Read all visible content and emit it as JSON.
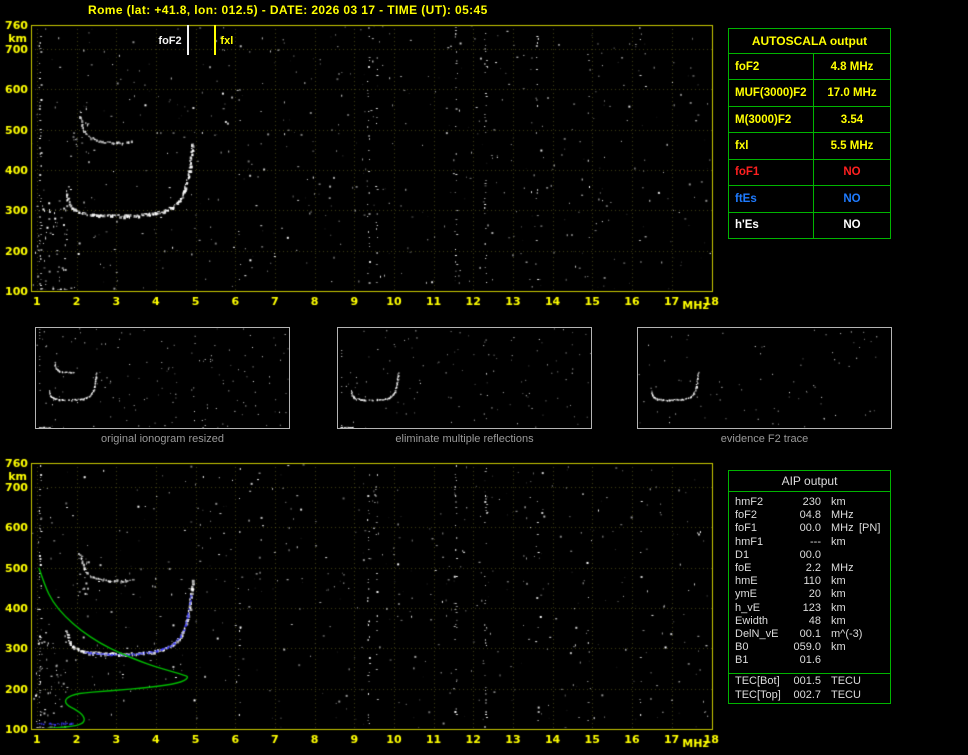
{
  "page": {
    "title": "Rome (lat: +41.8, lon: 012.5) - DATE: 2026 03 17 - TIME (UT): 05:45"
  },
  "colors": {
    "background": "#000000",
    "title_text": "#ffff00",
    "axis_text": "#ffff00",
    "plot_border": "#c8c800",
    "grid": "#bebe3c",
    "table_border": "#00b400",
    "profile_green": "#00bb00",
    "restored_blue": "#3c3cff",
    "echo_white": "#ffffff",
    "caption_gray": "#9a9a9a",
    "aip_text": "#dcdcdc"
  },
  "autoscala_table": {
    "title": "AUTOSCALA output",
    "rows": [
      {
        "param": "foF2",
        "value": "4.8 MHz",
        "color": "#ffff00"
      },
      {
        "param": "MUF(3000)F2",
        "value": "17.0 MHz",
        "color": "#ffff00"
      },
      {
        "param": "M(3000)F2",
        "value": "3.54",
        "color": "#ffff00"
      },
      {
        "param": "fxl",
        "value": "5.5 MHz",
        "color": "#ffff00"
      },
      {
        "param": "foF1",
        "value": "NO",
        "color": "#ff2020"
      },
      {
        "param": "ftEs",
        "value": "NO",
        "color": "#1f7bff"
      },
      {
        "param": "h'Es",
        "value": "NO",
        "color": "#ffffff"
      }
    ]
  },
  "mini_panels": [
    {
      "caption": "original ionogram resized"
    },
    {
      "caption": "eliminate multiple reflections"
    },
    {
      "caption": "evidence F2 trace"
    }
  ],
  "aip_table": {
    "title": "AIP output",
    "rows": [
      {
        "param": "hmF2",
        "value": "230",
        "unit": "km",
        "note": ""
      },
      {
        "param": "foF2",
        "value": "04.8",
        "unit": "MHz",
        "note": ""
      },
      {
        "param": "foF1",
        "value": "00.0",
        "unit": "MHz",
        "note": "[PN]"
      },
      {
        "param": "hmF1",
        "value": "---",
        "unit": "km",
        "note": ""
      },
      {
        "param": "D1",
        "value": "00.0",
        "unit": "",
        "note": ""
      },
      {
        "param": "foE",
        "value": "2.2",
        "unit": "MHz",
        "note": ""
      },
      {
        "param": "hmE",
        "value": "110",
        "unit": "km",
        "note": ""
      },
      {
        "param": "ymE",
        "value": "20",
        "unit": "km",
        "note": ""
      },
      {
        "param": "h_vE",
        "value": "123",
        "unit": "km",
        "note": ""
      },
      {
        "param": "Ewidth",
        "value": "48",
        "unit": "km",
        "note": ""
      },
      {
        "param": "DelN_vE",
        "value": "00.1",
        "unit": "m^(-3)",
        "note": ""
      },
      {
        "param": "B0",
        "value": "059.0",
        "unit": "km",
        "note": ""
      },
      {
        "param": "B1",
        "value": "01.6",
        "unit": "",
        "note": ""
      }
    ],
    "tec_rows": [
      {
        "param": "TEC[Bot]",
        "value": "001.5",
        "unit": "TECU"
      },
      {
        "param": "TEC[Top]",
        "value": "002.7",
        "unit": "TECU"
      }
    ]
  },
  "chart_data": [
    {
      "type": "scatter",
      "title": "Vertical ionogram with AUTOSCALA scaling markers",
      "xlabel": "MHz",
      "ylabel": "km",
      "xlim": [
        1,
        18
      ],
      "ylim": [
        100,
        760
      ],
      "x_ticks": [
        1,
        2,
        3,
        4,
        5,
        6,
        7,
        8,
        9,
        10,
        11,
        12,
        13,
        14,
        15,
        16,
        17,
        18
      ],
      "y_ticks": [
        760,
        700,
        600,
        500,
        400,
        300,
        200,
        100
      ],
      "grid": true,
      "markers": [
        {
          "label": "foF2",
          "freq_mhz": 4.8,
          "color": "#f2f2f2"
        },
        {
          "label": "fxl",
          "freq_mhz": 5.5,
          "color": "#ffff00"
        }
      ],
      "series": [
        {
          "name": "F2 trace first hop",
          "points": [
            [
              1.72,
              348
            ],
            [
              1.76,
              330
            ],
            [
              1.82,
              315
            ],
            [
              1.9,
              305
            ],
            [
              2.0,
              299
            ],
            [
              2.15,
              294
            ],
            [
              2.35,
              291
            ],
            [
              2.6,
              289
            ],
            [
              2.9,
              288
            ],
            [
              3.2,
              288
            ],
            [
              3.5,
              289
            ],
            [
              3.8,
              292
            ],
            [
              4.05,
              296
            ],
            [
              4.25,
              302
            ],
            [
              4.4,
              310
            ],
            [
              4.52,
              320
            ],
            [
              4.62,
              333
            ],
            [
              4.7,
              350
            ],
            [
              4.77,
              372
            ],
            [
              4.82,
              398
            ],
            [
              4.86,
              425
            ],
            [
              4.89,
              450
            ],
            [
              4.91,
              468
            ]
          ]
        },
        {
          "name": "F2 trace second reflection",
          "points": [
            [
              2.08,
              535
            ],
            [
              2.12,
              515
            ],
            [
              2.18,
              498
            ],
            [
              2.28,
              486
            ],
            [
              2.42,
              478
            ],
            [
              2.6,
              473
            ],
            [
              2.8,
              470
            ],
            [
              3.0,
              469
            ],
            [
              3.2,
              470
            ],
            [
              3.38,
              472
            ]
          ]
        },
        {
          "name": "E-region echoes",
          "points": [
            [
              1.0,
              104
            ],
            [
              1.12,
              105
            ],
            [
              1.25,
              104
            ],
            [
              1.4,
              106
            ],
            [
              1.55,
              105
            ],
            [
              1.7,
              106
            ],
            [
              1.82,
              108
            ]
          ]
        }
      ],
      "noise": {
        "random_count": 430,
        "gray_count": 110,
        "columns": [
          {
            "f": 1.07,
            "density": 0.4
          },
          {
            "f": 6.1,
            "density": 0.1
          },
          {
            "f": 9.35,
            "density": 0.3
          },
          {
            "f": 9.55,
            "density": 0.18
          },
          {
            "f": 11.55,
            "density": 0.26
          },
          {
            "f": 12.3,
            "density": 0.34
          },
          {
            "f": 13.6,
            "density": 0.12
          },
          {
            "f": 14.9,
            "density": 0.08
          },
          {
            "f": 16.2,
            "density": 0.1
          }
        ],
        "clusters": [
          {
            "f_range": [
              0.95,
              1.75
            ],
            "h_range": [
              110,
              340
            ],
            "count": 55
          },
          {
            "f_range": [
              1.9,
              2.3
            ],
            "h_range": [
              430,
              560
            ],
            "count": 18
          }
        ]
      }
    },
    {
      "type": "scatter",
      "title": "Ionogram with restored trace (blue) and electron density profile (green)",
      "xlabel": "MHz",
      "ylabel": "km",
      "xlim": [
        1,
        18
      ],
      "ylim": [
        100,
        760
      ],
      "x_ticks": [
        1,
        2,
        3,
        4,
        5,
        6,
        7,
        8,
        9,
        10,
        11,
        12,
        13,
        14,
        15,
        16,
        17,
        18
      ],
      "y_ticks": [
        760,
        700,
        600,
        500,
        400,
        300,
        200,
        100
      ],
      "grid": true,
      "series": [
        {
          "name": "F2 trace first hop",
          "points": [
            [
              1.72,
              348
            ],
            [
              1.76,
              330
            ],
            [
              1.82,
              315
            ],
            [
              1.9,
              305
            ],
            [
              2.0,
              299
            ],
            [
              2.15,
              294
            ],
            [
              2.35,
              291
            ],
            [
              2.6,
              289
            ],
            [
              2.9,
              288
            ],
            [
              3.2,
              288
            ],
            [
              3.5,
              289
            ],
            [
              3.8,
              292
            ],
            [
              4.05,
              296
            ],
            [
              4.25,
              302
            ],
            [
              4.4,
              310
            ],
            [
              4.52,
              320
            ],
            [
              4.62,
              333
            ],
            [
              4.7,
              350
            ],
            [
              4.77,
              372
            ],
            [
              4.82,
              398
            ],
            [
              4.86,
              425
            ],
            [
              4.89,
              450
            ],
            [
              4.91,
              468
            ]
          ]
        },
        {
          "name": "F2 trace second reflection",
          "points": [
            [
              2.08,
              535
            ],
            [
              2.12,
              515
            ],
            [
              2.18,
              498
            ],
            [
              2.28,
              486
            ],
            [
              2.42,
              478
            ],
            [
              2.6,
              473
            ],
            [
              2.8,
              470
            ],
            [
              3.0,
              469
            ],
            [
              3.2,
              470
            ],
            [
              3.38,
              472
            ]
          ]
        },
        {
          "name": "E-region echoes",
          "points": [
            [
              1.0,
              104
            ],
            [
              1.12,
              105
            ],
            [
              1.25,
              104
            ],
            [
              1.4,
              106
            ],
            [
              1.55,
              105
            ],
            [
              1.7,
              106
            ],
            [
              1.82,
              108
            ]
          ]
        },
        {
          "name": "restored F trace (blue)",
          "color": "#3c3cff",
          "points": [
            [
              2.2,
              292
            ],
            [
              2.35,
              290
            ],
            [
              2.5,
              288
            ],
            [
              2.65,
              287
            ],
            [
              2.8,
              286
            ],
            [
              2.95,
              286
            ],
            [
              3.1,
              286
            ],
            [
              3.25,
              286
            ],
            [
              3.4,
              287
            ],
            [
              3.55,
              288
            ],
            [
              3.7,
              290
            ],
            [
              3.85,
              292
            ],
            [
              4.0,
              295
            ],
            [
              4.15,
              299
            ],
            [
              4.3,
              305
            ],
            [
              4.45,
              314
            ],
            [
              4.55,
              325
            ],
            [
              4.65,
              340
            ],
            [
              4.73,
              360
            ],
            [
              4.79,
              385
            ],
            [
              4.84,
              412
            ],
            [
              4.87,
              435
            ]
          ]
        },
        {
          "name": "restored E trace (blue)",
          "color": "#3c3cff",
          "points": [
            [
              1.0,
              115
            ],
            [
              1.15,
              114
            ],
            [
              1.3,
              115
            ],
            [
              1.45,
              114
            ],
            [
              1.6,
              115
            ],
            [
              1.75,
              115
            ],
            [
              1.9,
              116
            ]
          ]
        },
        {
          "name": "electron density profile (green)",
          "color": "#00bb00",
          "points": [
            [
              1.05,
              500
            ],
            [
              1.2,
              455
            ],
            [
              1.4,
              415
            ],
            [
              1.7,
              380
            ],
            [
              2.1,
              345
            ],
            [
              2.6,
              312
            ],
            [
              3.1,
              288
            ],
            [
              3.6,
              268
            ],
            [
              4.0,
              254
            ],
            [
              4.35,
              244
            ],
            [
              4.6,
              237
            ],
            [
              4.75,
              232
            ],
            [
              4.8,
              230
            ],
            [
              4.78,
              224
            ],
            [
              4.65,
              217
            ],
            [
              4.4,
              211
            ],
            [
              4.05,
              206
            ],
            [
              3.6,
              201
            ],
            [
              3.1,
              197
            ],
            [
              2.6,
              193
            ],
            [
              2.2,
              190
            ],
            [
              1.95,
              186
            ],
            [
              1.8,
              180
            ],
            [
              1.72,
              173
            ],
            [
              1.72,
              165
            ],
            [
              1.8,
              157
            ],
            [
              1.95,
              149
            ],
            [
              2.08,
              141
            ],
            [
              2.17,
              132
            ],
            [
              2.2,
              123
            ],
            [
              2.16,
              115
            ],
            [
              2.05,
              110
            ],
            [
              1.9,
              107
            ],
            [
              1.65,
              104
            ],
            [
              1.35,
              102
            ],
            [
              1.05,
              100
            ]
          ]
        }
      ],
      "noise": {
        "random_count": 430,
        "gray_count": 110,
        "columns": [
          {
            "f": 1.07,
            "density": 0.4
          },
          {
            "f": 6.1,
            "density": 0.1
          },
          {
            "f": 9.35,
            "density": 0.3
          },
          {
            "f": 9.55,
            "density": 0.18
          },
          {
            "f": 11.55,
            "density": 0.26
          },
          {
            "f": 12.3,
            "density": 0.34
          },
          {
            "f": 13.6,
            "density": 0.12
          },
          {
            "f": 14.9,
            "density": 0.08
          },
          {
            "f": 16.2,
            "density": 0.1
          }
        ],
        "clusters": [
          {
            "f_range": [
              0.95,
              1.75
            ],
            "h_range": [
              110,
              340
            ],
            "count": 55
          },
          {
            "f_range": [
              1.9,
              2.3
            ],
            "h_range": [
              430,
              560
            ],
            "count": 18
          }
        ]
      }
    }
  ]
}
